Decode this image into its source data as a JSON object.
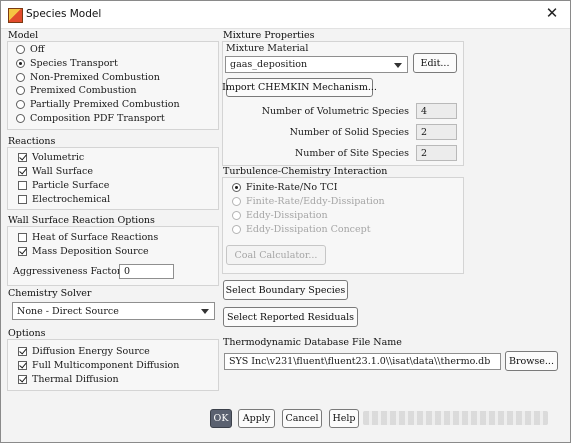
{
  "window": {
    "title": "Species Model",
    "close_icon": "close-icon",
    "app_icon": "species-app-icon"
  },
  "model": {
    "title": "Model",
    "options": [
      {
        "label": "Off",
        "selected": false
      },
      {
        "label": "Species Transport",
        "selected": true
      },
      {
        "label": "Non-Premixed Combustion",
        "selected": false
      },
      {
        "label": "Premixed Combustion",
        "selected": false
      },
      {
        "label": "Partially Premixed Combustion",
        "selected": false
      },
      {
        "label": "Composition PDF Transport",
        "selected": false
      }
    ]
  },
  "reactions": {
    "title": "Reactions",
    "options": [
      {
        "label": "Volumetric",
        "checked": true
      },
      {
        "label": "Wall Surface",
        "checked": true
      },
      {
        "label": "Particle Surface",
        "checked": false
      },
      {
        "label": "Electrochemical",
        "checked": false
      }
    ]
  },
  "wall_surface": {
    "title": "Wall Surface Reaction Options",
    "options": [
      {
        "label": "Heat of Surface Reactions",
        "checked": false
      },
      {
        "label": "Mass Deposition Source",
        "checked": true
      }
    ],
    "aggressiveness_label": "Aggressiveness Factor",
    "aggressiveness_value": "0"
  },
  "chemistry_solver": {
    "title": "Chemistry Solver",
    "selected": "None - Direct Source"
  },
  "options": {
    "title": "Options",
    "items": [
      {
        "label": "Diffusion Energy Source",
        "checked": true
      },
      {
        "label": "Full Multicomponent Diffusion",
        "checked": true
      },
      {
        "label": "Thermal Diffusion",
        "checked": true
      }
    ]
  },
  "mixture": {
    "title": "Mixture Properties",
    "material_label": "Mixture Material",
    "material_value": "gaas_deposition",
    "edit_button": "Edit...",
    "import_button": "Import CHEMKIN Mechanism...",
    "volumetric_label": "Number of Volumetric Species",
    "volumetric_value": "4",
    "solid_label": "Number of Solid Species",
    "solid_value": "2",
    "site_label": "Number of Site Species",
    "site_value": "2"
  },
  "turbulence": {
    "title": "Turbulence-Chemistry Interaction",
    "options": [
      {
        "label": "Finite-Rate/No TCI",
        "selected": true,
        "enabled": true
      },
      {
        "label": "Finite-Rate/Eddy-Dissipation",
        "selected": false,
        "enabled": false
      },
      {
        "label": "Eddy-Dissipation",
        "selected": false,
        "enabled": false
      },
      {
        "label": "Eddy-Dissipation Concept",
        "selected": false,
        "enabled": false
      }
    ],
    "coal_button": "Coal Calculator..."
  },
  "select_boundary_button": "Select Boundary Species",
  "select_residuals_button": "Select Reported Residuals",
  "thermo": {
    "title": "Thermodynamic Database File Name",
    "value": "SYS Inc\\v231\\fluent\\fluent23.1.0\\\\isat\\data\\\\thermo.db",
    "browse_button": "Browse..."
  },
  "footer": {
    "ok": "OK",
    "apply": "Apply",
    "cancel": "Cancel",
    "help": "Help"
  }
}
